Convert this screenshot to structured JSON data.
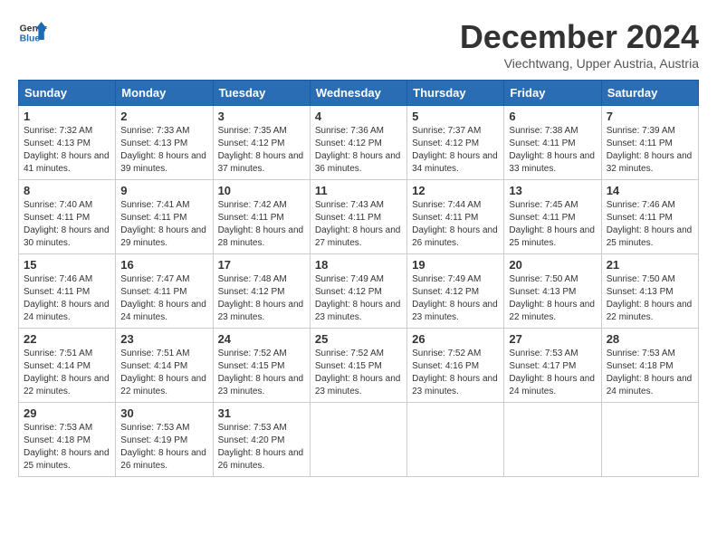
{
  "header": {
    "logo_line1": "General",
    "logo_line2": "Blue",
    "month_title": "December 2024",
    "location": "Viechtwang, Upper Austria, Austria"
  },
  "weekdays": [
    "Sunday",
    "Monday",
    "Tuesday",
    "Wednesday",
    "Thursday",
    "Friday",
    "Saturday"
  ],
  "weeks": [
    [
      {
        "day": "1",
        "sunrise": "Sunrise: 7:32 AM",
        "sunset": "Sunset: 4:13 PM",
        "daylight": "Daylight: 8 hours and 41 minutes."
      },
      {
        "day": "2",
        "sunrise": "Sunrise: 7:33 AM",
        "sunset": "Sunset: 4:13 PM",
        "daylight": "Daylight: 8 hours and 39 minutes."
      },
      {
        "day": "3",
        "sunrise": "Sunrise: 7:35 AM",
        "sunset": "Sunset: 4:12 PM",
        "daylight": "Daylight: 8 hours and 37 minutes."
      },
      {
        "day": "4",
        "sunrise": "Sunrise: 7:36 AM",
        "sunset": "Sunset: 4:12 PM",
        "daylight": "Daylight: 8 hours and 36 minutes."
      },
      {
        "day": "5",
        "sunrise": "Sunrise: 7:37 AM",
        "sunset": "Sunset: 4:12 PM",
        "daylight": "Daylight: 8 hours and 34 minutes."
      },
      {
        "day": "6",
        "sunrise": "Sunrise: 7:38 AM",
        "sunset": "Sunset: 4:11 PM",
        "daylight": "Daylight: 8 hours and 33 minutes."
      },
      {
        "day": "7",
        "sunrise": "Sunrise: 7:39 AM",
        "sunset": "Sunset: 4:11 PM",
        "daylight": "Daylight: 8 hours and 32 minutes."
      }
    ],
    [
      {
        "day": "8",
        "sunrise": "Sunrise: 7:40 AM",
        "sunset": "Sunset: 4:11 PM",
        "daylight": "Daylight: 8 hours and 30 minutes."
      },
      {
        "day": "9",
        "sunrise": "Sunrise: 7:41 AM",
        "sunset": "Sunset: 4:11 PM",
        "daylight": "Daylight: 8 hours and 29 minutes."
      },
      {
        "day": "10",
        "sunrise": "Sunrise: 7:42 AM",
        "sunset": "Sunset: 4:11 PM",
        "daylight": "Daylight: 8 hours and 28 minutes."
      },
      {
        "day": "11",
        "sunrise": "Sunrise: 7:43 AM",
        "sunset": "Sunset: 4:11 PM",
        "daylight": "Daylight: 8 hours and 27 minutes."
      },
      {
        "day": "12",
        "sunrise": "Sunrise: 7:44 AM",
        "sunset": "Sunset: 4:11 PM",
        "daylight": "Daylight: 8 hours and 26 minutes."
      },
      {
        "day": "13",
        "sunrise": "Sunrise: 7:45 AM",
        "sunset": "Sunset: 4:11 PM",
        "daylight": "Daylight: 8 hours and 25 minutes."
      },
      {
        "day": "14",
        "sunrise": "Sunrise: 7:46 AM",
        "sunset": "Sunset: 4:11 PM",
        "daylight": "Daylight: 8 hours and 25 minutes."
      }
    ],
    [
      {
        "day": "15",
        "sunrise": "Sunrise: 7:46 AM",
        "sunset": "Sunset: 4:11 PM",
        "daylight": "Daylight: 8 hours and 24 minutes."
      },
      {
        "day": "16",
        "sunrise": "Sunrise: 7:47 AM",
        "sunset": "Sunset: 4:11 PM",
        "daylight": "Daylight: 8 hours and 24 minutes."
      },
      {
        "day": "17",
        "sunrise": "Sunrise: 7:48 AM",
        "sunset": "Sunset: 4:12 PM",
        "daylight": "Daylight: 8 hours and 23 minutes."
      },
      {
        "day": "18",
        "sunrise": "Sunrise: 7:49 AM",
        "sunset": "Sunset: 4:12 PM",
        "daylight": "Daylight: 8 hours and 23 minutes."
      },
      {
        "day": "19",
        "sunrise": "Sunrise: 7:49 AM",
        "sunset": "Sunset: 4:12 PM",
        "daylight": "Daylight: 8 hours and 23 minutes."
      },
      {
        "day": "20",
        "sunrise": "Sunrise: 7:50 AM",
        "sunset": "Sunset: 4:13 PM",
        "daylight": "Daylight: 8 hours and 22 minutes."
      },
      {
        "day": "21",
        "sunrise": "Sunrise: 7:50 AM",
        "sunset": "Sunset: 4:13 PM",
        "daylight": "Daylight: 8 hours and 22 minutes."
      }
    ],
    [
      {
        "day": "22",
        "sunrise": "Sunrise: 7:51 AM",
        "sunset": "Sunset: 4:14 PM",
        "daylight": "Daylight: 8 hours and 22 minutes."
      },
      {
        "day": "23",
        "sunrise": "Sunrise: 7:51 AM",
        "sunset": "Sunset: 4:14 PM",
        "daylight": "Daylight: 8 hours and 22 minutes."
      },
      {
        "day": "24",
        "sunrise": "Sunrise: 7:52 AM",
        "sunset": "Sunset: 4:15 PM",
        "daylight": "Daylight: 8 hours and 23 minutes."
      },
      {
        "day": "25",
        "sunrise": "Sunrise: 7:52 AM",
        "sunset": "Sunset: 4:15 PM",
        "daylight": "Daylight: 8 hours and 23 minutes."
      },
      {
        "day": "26",
        "sunrise": "Sunrise: 7:52 AM",
        "sunset": "Sunset: 4:16 PM",
        "daylight": "Daylight: 8 hours and 23 minutes."
      },
      {
        "day": "27",
        "sunrise": "Sunrise: 7:53 AM",
        "sunset": "Sunset: 4:17 PM",
        "daylight": "Daylight: 8 hours and 24 minutes."
      },
      {
        "day": "28",
        "sunrise": "Sunrise: 7:53 AM",
        "sunset": "Sunset: 4:18 PM",
        "daylight": "Daylight: 8 hours and 24 minutes."
      }
    ],
    [
      {
        "day": "29",
        "sunrise": "Sunrise: 7:53 AM",
        "sunset": "Sunset: 4:18 PM",
        "daylight": "Daylight: 8 hours and 25 minutes."
      },
      {
        "day": "30",
        "sunrise": "Sunrise: 7:53 AM",
        "sunset": "Sunset: 4:19 PM",
        "daylight": "Daylight: 8 hours and 26 minutes."
      },
      {
        "day": "31",
        "sunrise": "Sunrise: 7:53 AM",
        "sunset": "Sunset: 4:20 PM",
        "daylight": "Daylight: 8 hours and 26 minutes."
      },
      null,
      null,
      null,
      null
    ]
  ]
}
